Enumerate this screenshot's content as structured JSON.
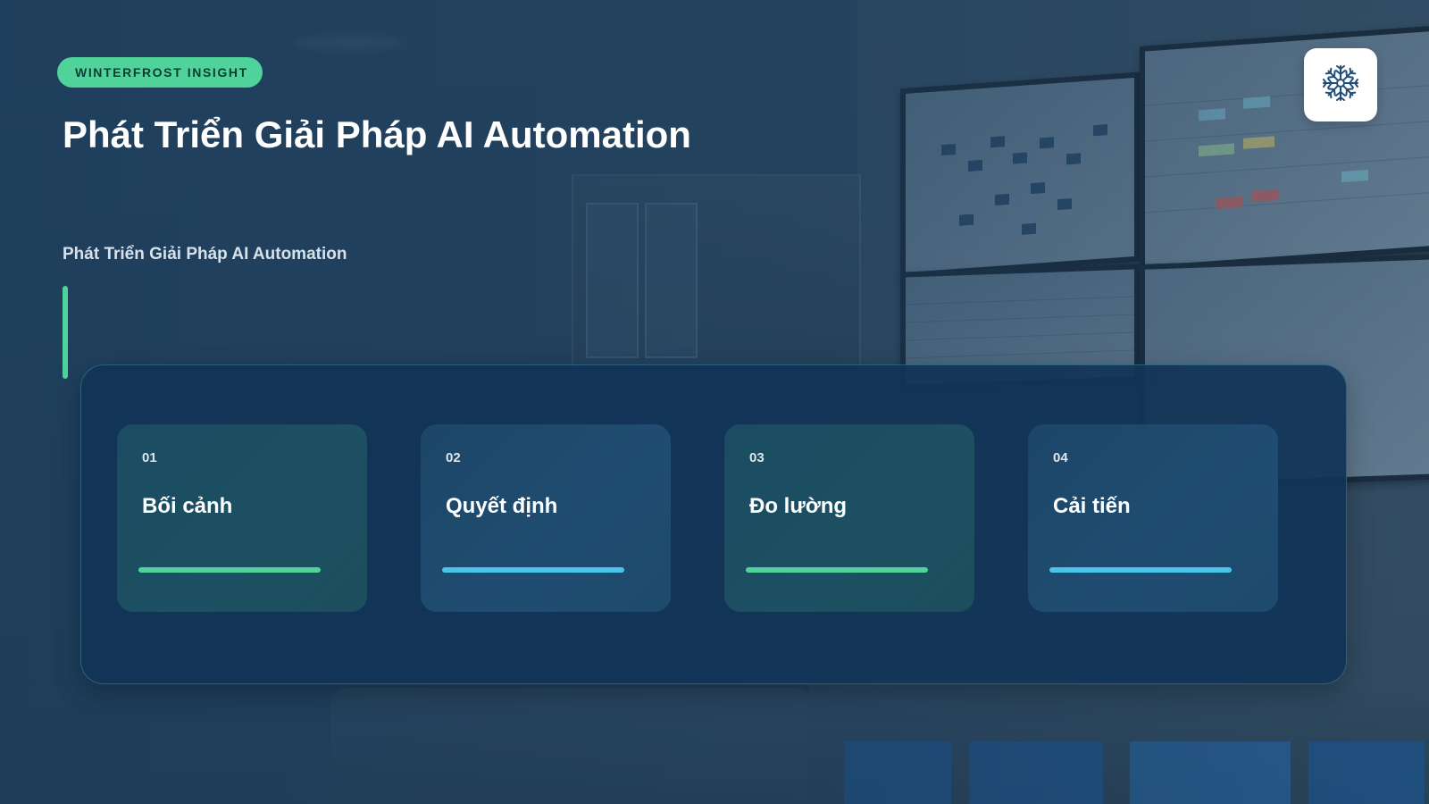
{
  "brand": {
    "label": "WINTERFROST INSIGHT",
    "accent_color": "#4fd39a"
  },
  "header": {
    "title": "Phát Triển Giải Pháp AI Automation",
    "logo_icon": "snowflake-icon"
  },
  "subtitle": "Phát Triển Giải Pháp AI Automation",
  "steps": [
    {
      "number": "01",
      "title": "Bối cảnh",
      "accent": "green",
      "bar_color": "#4fd39a"
    },
    {
      "number": "02",
      "title": "Quyết định",
      "accent": "blue",
      "bar_color": "#4cc3ea"
    },
    {
      "number": "03",
      "title": "Đo lường",
      "accent": "green",
      "bar_color": "#4fd39a"
    },
    {
      "number": "04",
      "title": "Cải tiến",
      "accent": "blue",
      "bar_color": "#4cc3ea"
    }
  ],
  "colors": {
    "panel": "#11345a",
    "green_accent": "#4fd39a",
    "blue_accent": "#4cc3ea"
  }
}
